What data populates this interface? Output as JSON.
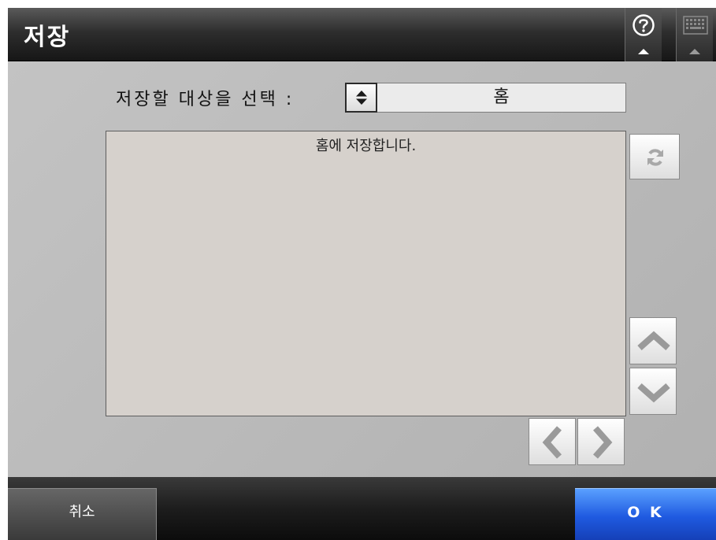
{
  "header": {
    "title": "저장",
    "help_icon": "help-circle-icon",
    "keyboard_icon": "keyboard-icon"
  },
  "destination": {
    "label": "저장할 대상을 선택 :",
    "selected_value": "홈",
    "select_icon": "up-down-arrows-icon"
  },
  "content": {
    "message": "홈에 저장합니다."
  },
  "side_controls": {
    "refresh_icon": "refresh-icon",
    "scroll_up_icon": "chevron-up-icon",
    "scroll_down_icon": "chevron-down-icon",
    "page_prev_icon": "chevron-left-icon",
    "page_next_icon": "chevron-right-icon"
  },
  "footer": {
    "cancel_label": "취소",
    "ok_label": "O K"
  },
  "colors": {
    "header_bg": "#2e2e2e",
    "main_bg": "#bcbcbc",
    "content_bg": "#d6d1cc",
    "ok_button": "#1f5ae0",
    "cancel_button": "#4f4f4f"
  }
}
